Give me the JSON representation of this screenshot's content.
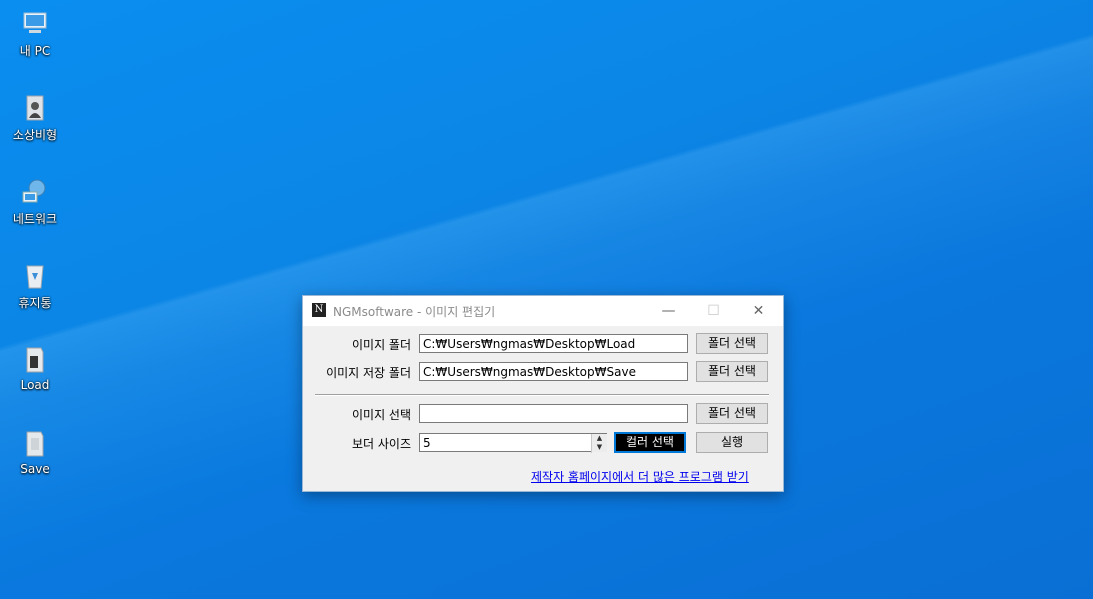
{
  "desktop": {
    "icons": [
      {
        "label": "내 PC",
        "icon": "computer-icon"
      },
      {
        "label": "소상비형",
        "icon": "user-folder-icon"
      },
      {
        "label": "네트워크",
        "icon": "network-icon"
      },
      {
        "label": "휴지통",
        "icon": "recycle-bin-icon"
      },
      {
        "label": "Load",
        "icon": "folder-icon"
      },
      {
        "label": "Save",
        "icon": "folder-icon"
      }
    ]
  },
  "window": {
    "title": "NGMsoftware - 이미지 편집기",
    "app_icon_text": "N",
    "minimize_symbol": "—",
    "maximize_symbol": "☐",
    "close_symbol": "✕",
    "image_folder_label": "이미지 폴더",
    "image_folder_value": "C:₩Users₩ngmas₩Desktop₩Load",
    "image_save_folder_label": "이미지 저장 폴더",
    "image_save_folder_value": "C:₩Users₩ngmas₩Desktop₩Save",
    "image_select_label": "이미지 선택",
    "image_select_value": "",
    "border_size_label": "보더 사이즈",
    "border_size_value": "5",
    "folder_select_label": "폴더 선택",
    "color_select_label": "컬러 선택",
    "run_label": "실행",
    "homepage_link": "제작자 홈페이지에서 더 많은 프로그램 받기"
  },
  "colors": {
    "desktop_blue": "#0a86e8",
    "link": "#0000ee",
    "color_button_bg": "#000000"
  }
}
